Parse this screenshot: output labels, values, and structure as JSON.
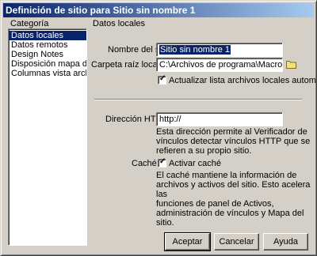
{
  "window": {
    "title": "Definición de sitio para Sitio sin nombre 1"
  },
  "category": {
    "heading": "Categoría",
    "items": [
      "Datos locales",
      "Datos remotos",
      "Design Notes",
      "Disposición mapa del sitio",
      "Columnas vista archivo"
    ],
    "selected_index": 0
  },
  "panel": {
    "heading": "Datos locales",
    "site_name_label": "Nombre del sitio:",
    "site_name_value": "Sitio sin nombre 1",
    "root_folder_label": "Carpeta raíz local:",
    "root_folder_value": "C:\\Archivos de programa\\Macromedia\\Dre",
    "auto_refresh_label": "Actualizar lista archivos locales autom.",
    "auto_refresh_checked": true,
    "http_label": "Dirección HTTP:",
    "http_value": "http://",
    "http_description": [
      "Esta dirección permite al Verificador de",
      "vínculos detectar vínculos HTTP que se",
      "refieren a su propio sitio."
    ],
    "cache_label": "Caché:",
    "cache_checkbox_label": "Activar caché",
    "cache_checked": true,
    "cache_description": [
      "El caché mantiene la información de",
      "archivos y activos del sitio. Esto acelera las",
      "funciones de panel de Activos,",
      "administración de vínculos y Mapa del sitio."
    ]
  },
  "buttons": {
    "ok": "Aceptar",
    "cancel": "Cancelar",
    "help": "Ayuda"
  },
  "icons": {
    "folder": "folder-icon",
    "check": "checkmark-icon"
  },
  "colors": {
    "title_start": "#0a246a",
    "title_end": "#a6caf0",
    "face": "#d4d0c8",
    "selection": "#0a246a"
  }
}
